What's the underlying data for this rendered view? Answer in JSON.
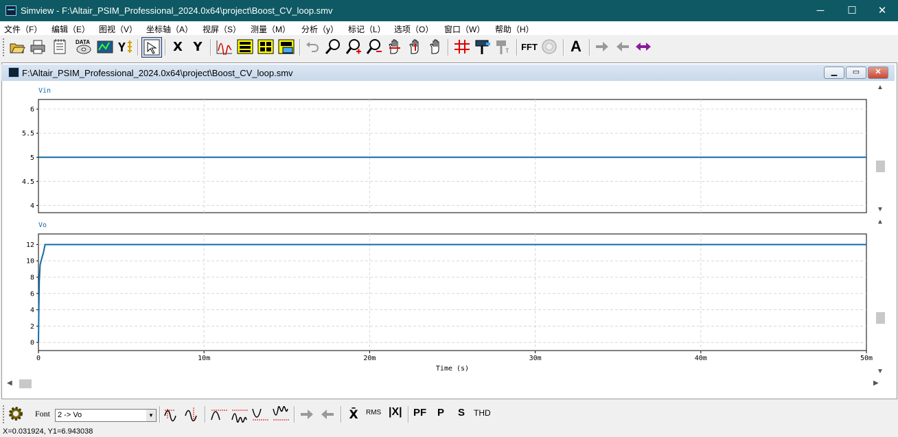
{
  "window": {
    "title": "Simview - F:\\Altair_PSIM_Professional_2024.0x64\\project\\Boost_CV_loop.smv",
    "min": "─",
    "max": "☐",
    "close": "✕"
  },
  "menu": [
    "文件（F）",
    "编辑（E）",
    "图视（V）",
    "坐标轴（A）",
    "视屏（S）",
    "测量（M）",
    "分析（y）",
    "标记（L）",
    "选项（O）",
    "窗口（W）",
    "帮助（H）"
  ],
  "toolbar": {
    "x_label": "X",
    "y_label": "Y",
    "fft_label": "FFT",
    "text_label": "A",
    "data_label": "DATA"
  },
  "child": {
    "title": "F:\\Altair_PSIM_Professional_2024.0x64\\project\\Boost_CV_loop.smv"
  },
  "colors": {
    "trace": "#0f6aa8",
    "grid": "#d8d8d8",
    "titlebar": "#0e5964"
  },
  "chart_data": [
    {
      "type": "line",
      "title": "Vin",
      "series": [
        {
          "name": "Vin",
          "x": [
            0,
            0.05
          ],
          "y": [
            5,
            5
          ]
        }
      ],
      "xlim": [
        0,
        0.05
      ],
      "ylim": [
        3.85,
        6.2
      ],
      "yticks": [
        "6",
        "5.5",
        "5",
        "4.5",
        "4"
      ],
      "grid": true
    },
    {
      "type": "line",
      "title": "Vo",
      "series": [
        {
          "name": "Vo",
          "x": [
            0,
            2e-05,
            5e-05,
            0.0001,
            0.0002,
            0.0003,
            0.0004,
            0.0006,
            0.05
          ],
          "y": [
            0,
            3.5,
            7.5,
            9.5,
            10.3,
            11.0,
            12.0,
            12.0,
            12.0
          ]
        }
      ],
      "xlim": [
        0,
        0.05
      ],
      "ylim": [
        -1,
        13.3
      ],
      "yticks": [
        "12",
        "10",
        "8",
        "6",
        "4",
        "2",
        "0"
      ],
      "xticks": [
        "0",
        "10m",
        "20m",
        "30m",
        "40m",
        "50m"
      ],
      "xlabel": "Time (s)",
      "grid": true
    }
  ],
  "bottom": {
    "font_label": "Font",
    "combo_value": "2 -> Vo",
    "rms": "RMS",
    "absx": "|X|",
    "pf": "PF",
    "p": "P",
    "s": "S",
    "thd": "THD",
    "xbar": "X̄"
  },
  "status": "X=0.031924, Y1=6.943038"
}
